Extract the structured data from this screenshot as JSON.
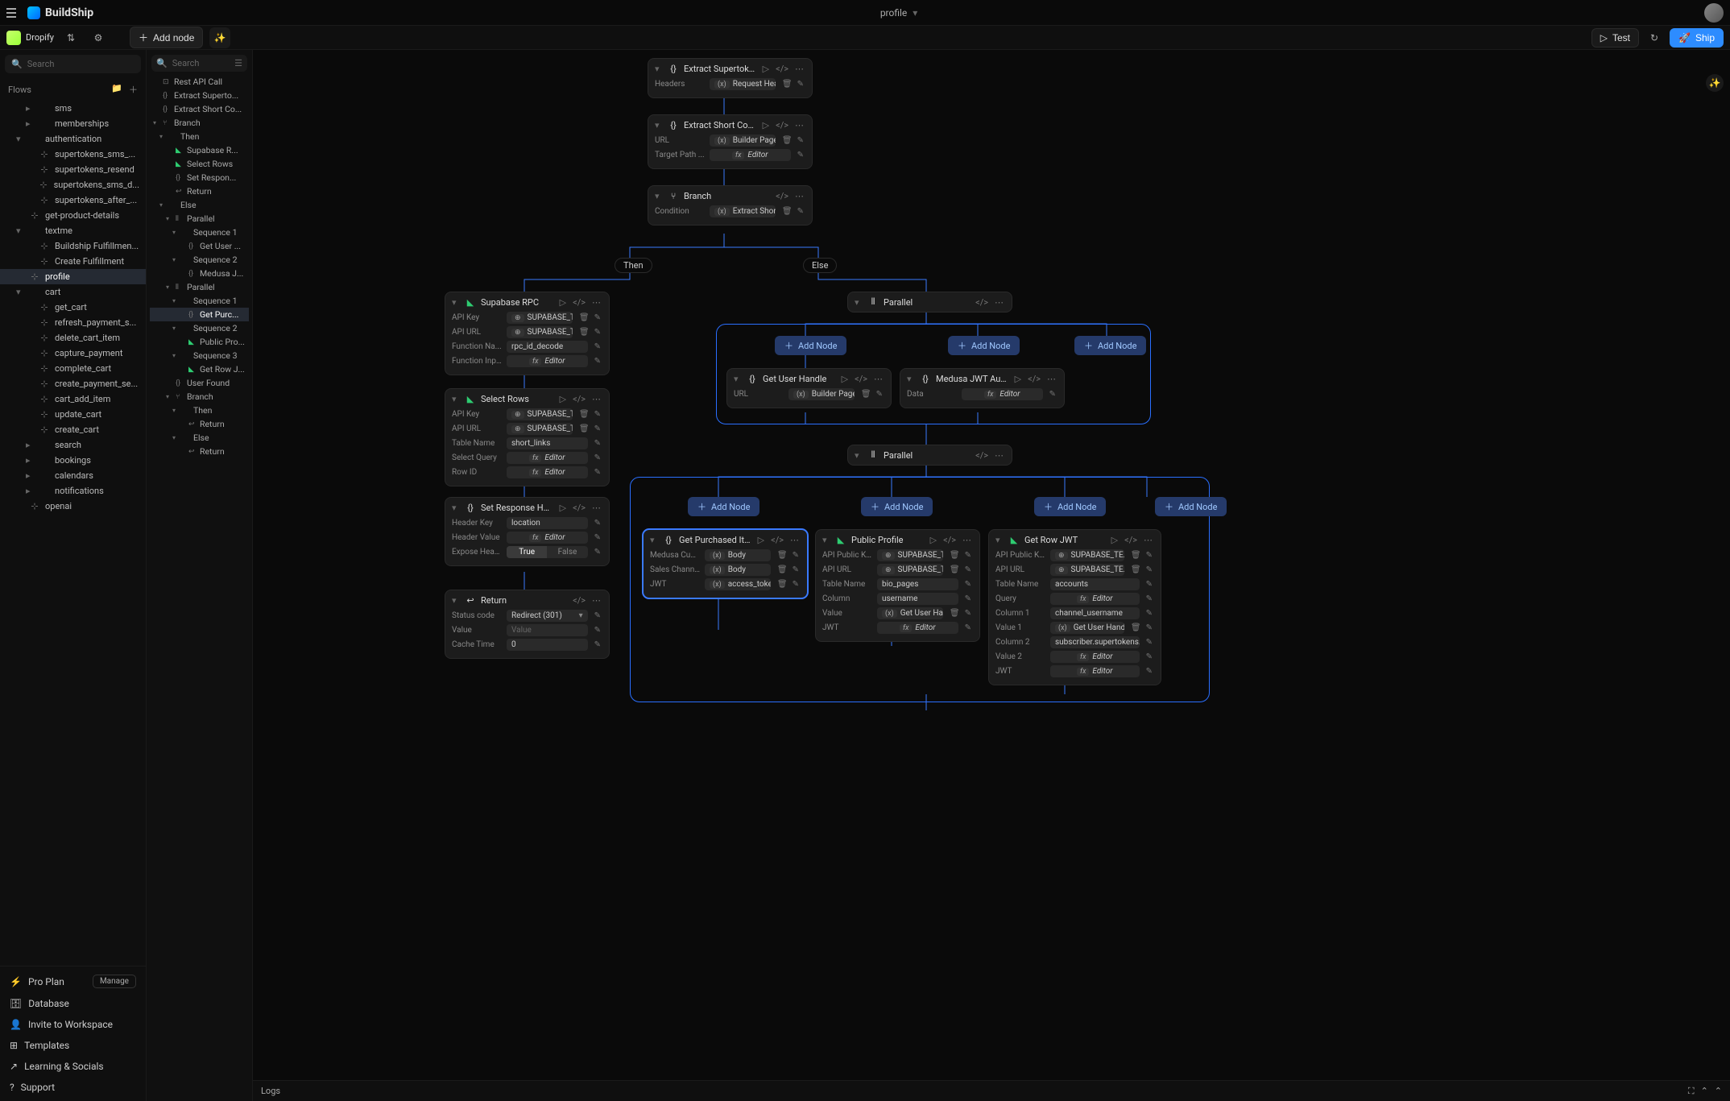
{
  "brand": "BuildShip",
  "top": {
    "profile_label": "profile",
    "test": "Test",
    "ship": "Ship"
  },
  "workspace": {
    "name": "Dropify"
  },
  "toolbar": {
    "add_node": "Add node"
  },
  "search": {
    "placeholder": "Search"
  },
  "flows_label": "Flows",
  "flows": [
    {
      "l": "sms",
      "d": 2
    },
    {
      "l": "memberships",
      "d": 2
    },
    {
      "l": "authentication",
      "d": 1,
      "open": true
    },
    {
      "l": "supertokens_sms_...",
      "d": 2,
      "ic": "flow"
    },
    {
      "l": "supertokens_resend",
      "d": 2,
      "ic": "flow"
    },
    {
      "l": "supertokens_sms_d...",
      "d": 2,
      "ic": "flow"
    },
    {
      "l": "supertokens_after_...",
      "d": 2,
      "ic": "flow"
    },
    {
      "l": "get-product-details",
      "d": 1,
      "ic": "flow"
    },
    {
      "l": "textme",
      "d": 1,
      "open": true
    },
    {
      "l": "Buildship Fulfillmen...",
      "d": 2,
      "ic": "flow"
    },
    {
      "l": "Create Fulfillment",
      "d": 2,
      "ic": "flow"
    },
    {
      "l": "profile",
      "d": 1,
      "ic": "flow",
      "active": true
    },
    {
      "l": "cart",
      "d": 1,
      "open": true
    },
    {
      "l": "get_cart",
      "d": 2,
      "ic": "flow"
    },
    {
      "l": "refresh_payment_s...",
      "d": 2,
      "ic": "flow"
    },
    {
      "l": "delete_cart_item",
      "d": 2,
      "ic": "flow"
    },
    {
      "l": "capture_payment",
      "d": 2,
      "ic": "flow"
    },
    {
      "l": "complete_cart",
      "d": 2,
      "ic": "flow"
    },
    {
      "l": "create_payment_se...",
      "d": 2,
      "ic": "flow"
    },
    {
      "l": "cart_add_item",
      "d": 2,
      "ic": "flow"
    },
    {
      "l": "update_cart",
      "d": 2,
      "ic": "flow"
    },
    {
      "l": "create_cart",
      "d": 2,
      "ic": "flow"
    },
    {
      "l": "search",
      "d": 2
    },
    {
      "l": "bookings",
      "d": 2
    },
    {
      "l": "calendars",
      "d": 2
    },
    {
      "l": "notifications",
      "d": 2
    },
    {
      "l": "openai",
      "d": 1,
      "ic": "flow"
    }
  ],
  "sidebar_bottom": {
    "pro": "Pro Plan",
    "manage": "Manage",
    "database": "Database",
    "invite": "Invite to Workspace",
    "templates": "Templates",
    "learning": "Learning & Socials",
    "support": "Support"
  },
  "outline": [
    {
      "l": "Rest API Call",
      "d": 0,
      "ic": "api"
    },
    {
      "l": "Extract Superto...",
      "d": 0,
      "ic": "code"
    },
    {
      "l": "Extract Short Co...",
      "d": 0,
      "ic": "code"
    },
    {
      "l": "Branch",
      "d": 0,
      "ic": "branch",
      "open": true
    },
    {
      "l": "Then",
      "d": 1,
      "open": true
    },
    {
      "l": "Supabase R...",
      "d": 2,
      "ic": "green"
    },
    {
      "l": "Select Rows",
      "d": 2,
      "ic": "green"
    },
    {
      "l": "Set Respon...",
      "d": 2,
      "ic": "code"
    },
    {
      "l": "Return",
      "d": 2,
      "ic": "ret"
    },
    {
      "l": "Else",
      "d": 1,
      "open": true
    },
    {
      "l": "Parallel",
      "d": 2,
      "ic": "par",
      "open": true
    },
    {
      "l": "Sequence 1",
      "d": 3,
      "open": true
    },
    {
      "l": "Get User ...",
      "d": 4,
      "ic": "code"
    },
    {
      "l": "Sequence 2",
      "d": 3,
      "open": true
    },
    {
      "l": "Medusa J...",
      "d": 4,
      "ic": "code"
    },
    {
      "l": "Parallel",
      "d": 2,
      "ic": "par",
      "open": true
    },
    {
      "l": "Sequence 1",
      "d": 3,
      "open": true
    },
    {
      "l": "Get Purc...",
      "d": 4,
      "ic": "code",
      "active": true
    },
    {
      "l": "Sequence 2",
      "d": 3,
      "open": true
    },
    {
      "l": "Public Pro...",
      "d": 4,
      "ic": "green"
    },
    {
      "l": "Sequence 3",
      "d": 3,
      "open": true
    },
    {
      "l": "Get Row J...",
      "d": 4,
      "ic": "green"
    },
    {
      "l": "User Found",
      "d": 2,
      "ic": "code"
    },
    {
      "l": "Branch",
      "d": 2,
      "ic": "branch",
      "open": true
    },
    {
      "l": "Then",
      "d": 3,
      "open": true
    },
    {
      "l": "Return",
      "d": 4,
      "ic": "ret"
    },
    {
      "l": "Else",
      "d": 3,
      "open": true
    },
    {
      "l": "Return",
      "d": 4,
      "ic": "ret"
    }
  ],
  "nodes": {
    "extract_super": {
      "title": "Extract Supertoken...",
      "rows": [
        {
          "label": "Headers",
          "val": "Request Head...",
          "tag": "(x)",
          "acts": [
            "del",
            "edit"
          ]
        }
      ]
    },
    "extract_short": {
      "title": "Extract Short Code",
      "rows": [
        {
          "label": "URL",
          "val": "Builder Page U...",
          "tag": "(x)",
          "acts": [
            "del",
            "edit"
          ]
        },
        {
          "label": "Target Path ...",
          "val": "Editor",
          "ed": true,
          "tag": "fx",
          "acts": [
            "edit"
          ]
        }
      ]
    },
    "branch": {
      "title": "Branch",
      "rows": [
        {
          "label": "Condition",
          "val": "Extract Short ...",
          "tag": "(x)",
          "acts": [
            "del",
            "edit"
          ]
        }
      ]
    },
    "then_label": "Then",
    "else_label": "Else",
    "supabase_rpc": {
      "title": "Supabase RPC",
      "rows": [
        {
          "label": "API Key",
          "val": "SUPABASE_TE...",
          "tag": "⊕",
          "acts": [
            "del",
            "edit"
          ]
        },
        {
          "label": "API URL",
          "val": "SUPABASE_TE...",
          "tag": "⊕",
          "acts": [
            "del",
            "edit"
          ]
        },
        {
          "label": "Function Na...",
          "val": "rpc_id_decode",
          "acts": [
            "edit"
          ]
        },
        {
          "label": "Function Inp...",
          "val": "Editor",
          "ed": true,
          "tag": "fx",
          "acts": [
            "edit"
          ]
        }
      ]
    },
    "select_rows": {
      "title": "Select Rows",
      "rows": [
        {
          "label": "API Key",
          "val": "SUPABASE_TE...",
          "tag": "⊕",
          "acts": [
            "del",
            "edit"
          ]
        },
        {
          "label": "API URL",
          "val": "SUPABASE_TE...",
          "tag": "⊕",
          "acts": [
            "del",
            "edit"
          ]
        },
        {
          "label": "Table Name",
          "val": "short_links",
          "acts": [
            "edit"
          ]
        },
        {
          "label": "Select Query",
          "val": "Editor",
          "ed": true,
          "tag": "fx",
          "acts": [
            "edit"
          ]
        },
        {
          "label": "Row ID",
          "val": "Editor",
          "ed": true,
          "tag": "fx",
          "acts": [
            "edit"
          ]
        }
      ]
    },
    "set_resp": {
      "title": "Set Response Head...",
      "rows": [
        {
          "label": "Header Key",
          "val": "location",
          "acts": [
            "edit"
          ]
        },
        {
          "label": "Header Value",
          "val": "Editor",
          "ed": true,
          "tag": "fx",
          "acts": [
            "edit"
          ]
        },
        {
          "label": "Expose Head...",
          "toggle": {
            "on": "True",
            "off": "False"
          },
          "acts": [
            "edit"
          ]
        }
      ]
    },
    "return1": {
      "title": "Return",
      "rows": [
        {
          "label": "Status code",
          "val": "Redirect (301)",
          "select": true,
          "acts": [
            "edit"
          ]
        },
        {
          "label": "Value",
          "val": "Value",
          "ph": true,
          "acts": [
            "edit"
          ]
        },
        {
          "label": "Cache Time",
          "val": "0",
          "acts": [
            "edit"
          ]
        }
      ]
    },
    "parallel1": {
      "title": "Parallel"
    },
    "parallel2": {
      "title": "Parallel"
    },
    "add_node_label": "Add Node",
    "get_user": {
      "title": "Get User Handle",
      "rows": [
        {
          "label": "URL",
          "val": "Builder Page U...",
          "tag": "(x)",
          "acts": [
            "del",
            "edit"
          ]
        }
      ]
    },
    "medusa": {
      "title": "Medusa JWT Auth",
      "rows": [
        {
          "label": "Data",
          "val": "Editor",
          "ed": true,
          "tag": "fx",
          "acts": [
            "edit"
          ]
        }
      ]
    },
    "get_purchased": {
      "title": "Get Purchased Items",
      "rows": [
        {
          "label": "Medusa Cust...",
          "val": "Body",
          "tag": "(x)",
          "acts": [
            "del",
            "edit"
          ]
        },
        {
          "label": "Sales Chann...",
          "val": "Body",
          "tag": "(x)",
          "acts": [
            "del",
            "edit"
          ]
        },
        {
          "label": "JWT",
          "val": "access_token",
          "tag": "(x)",
          "acts": [
            "del",
            "edit"
          ]
        }
      ]
    },
    "public_profile": {
      "title": "Public Profile",
      "rows": [
        {
          "label": "API Public Key",
          "val": "SUPABASE_T...",
          "tag": "⊕",
          "acts": [
            "del",
            "edit"
          ]
        },
        {
          "label": "API URL",
          "val": "SUPABASE_T...",
          "tag": "⊕",
          "acts": [
            "del",
            "edit"
          ]
        },
        {
          "label": "Table Name",
          "val": "bio_pages",
          "acts": [
            "edit"
          ]
        },
        {
          "label": "Column",
          "val": "username",
          "acts": [
            "edit"
          ]
        },
        {
          "label": "Value",
          "val": "Get User Handle",
          "tag": "(x)",
          "acts": [
            "del",
            "edit"
          ]
        },
        {
          "label": "JWT",
          "val": "Editor",
          "ed": true,
          "tag": "fx",
          "acts": [
            "edit"
          ]
        }
      ]
    },
    "get_row_jwt": {
      "title": "Get Row JWT",
      "rows": [
        {
          "label": "API Public Key",
          "val": "SUPABASE_TE...",
          "tag": "⊕",
          "acts": [
            "del",
            "edit"
          ]
        },
        {
          "label": "API URL",
          "val": "SUPABASE_TE...",
          "tag": "⊕",
          "acts": [
            "del",
            "edit"
          ]
        },
        {
          "label": "Table Name",
          "val": "accounts",
          "acts": [
            "edit"
          ]
        },
        {
          "label": "Query",
          "val": "Editor",
          "ed": true,
          "tag": "fx",
          "acts": [
            "edit"
          ]
        },
        {
          "label": "Column 1",
          "val": "channel_username",
          "acts": [
            "edit"
          ]
        },
        {
          "label": "Value 1",
          "val": "Get User Handle",
          "tag": "(x)",
          "acts": [
            "del",
            "edit"
          ]
        },
        {
          "label": "Column 2",
          "val": "subscriber.supertokens...",
          "acts": [
            "edit"
          ]
        },
        {
          "label": "Value 2",
          "val": "Editor",
          "ed": true,
          "tag": "fx",
          "acts": [
            "edit"
          ]
        },
        {
          "label": "JWT",
          "val": "Editor",
          "ed": true,
          "tag": "fx",
          "acts": [
            "edit"
          ]
        }
      ]
    }
  },
  "logs_label": "Logs"
}
